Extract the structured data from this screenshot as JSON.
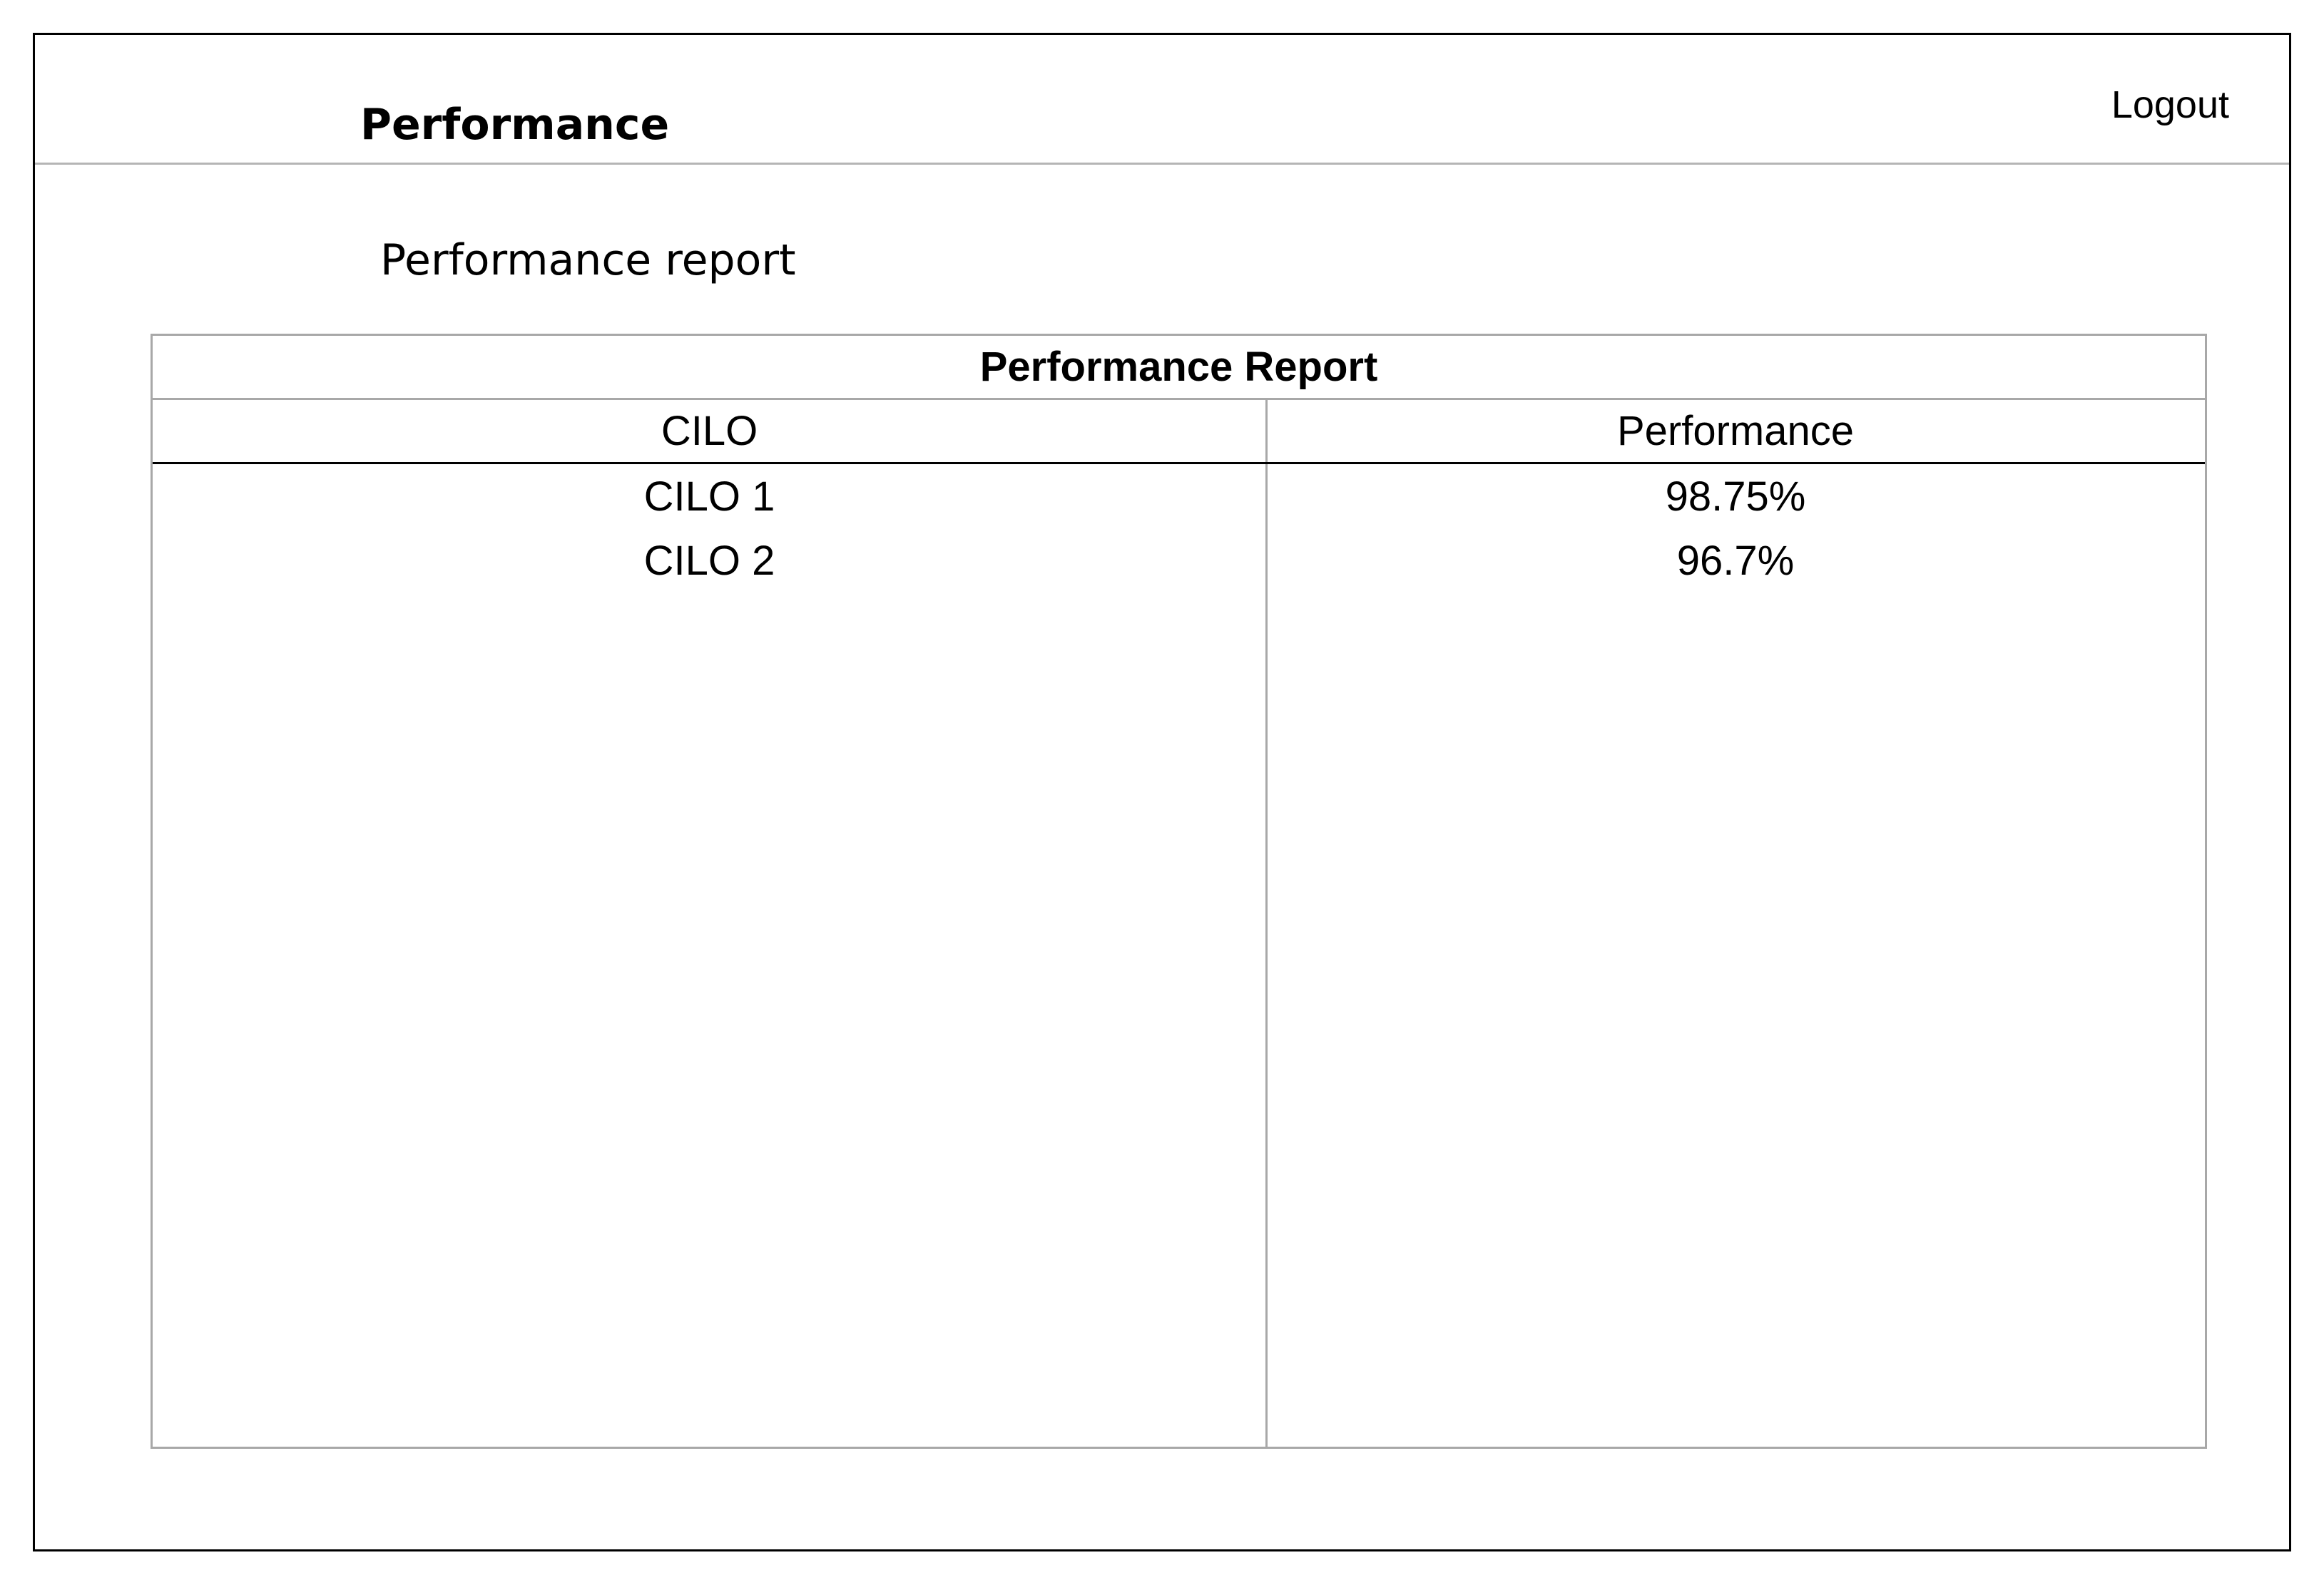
{
  "header": {
    "title": "Performance",
    "logout_label": "Logout"
  },
  "main": {
    "section_title": "Performance report",
    "table": {
      "caption": "Performance Report",
      "columns": [
        "CILO",
        "Performance"
      ],
      "rows": [
        [
          "CILO 1",
          "98.75%"
        ],
        [
          "CILO 2",
          "96.7%"
        ]
      ]
    }
  }
}
